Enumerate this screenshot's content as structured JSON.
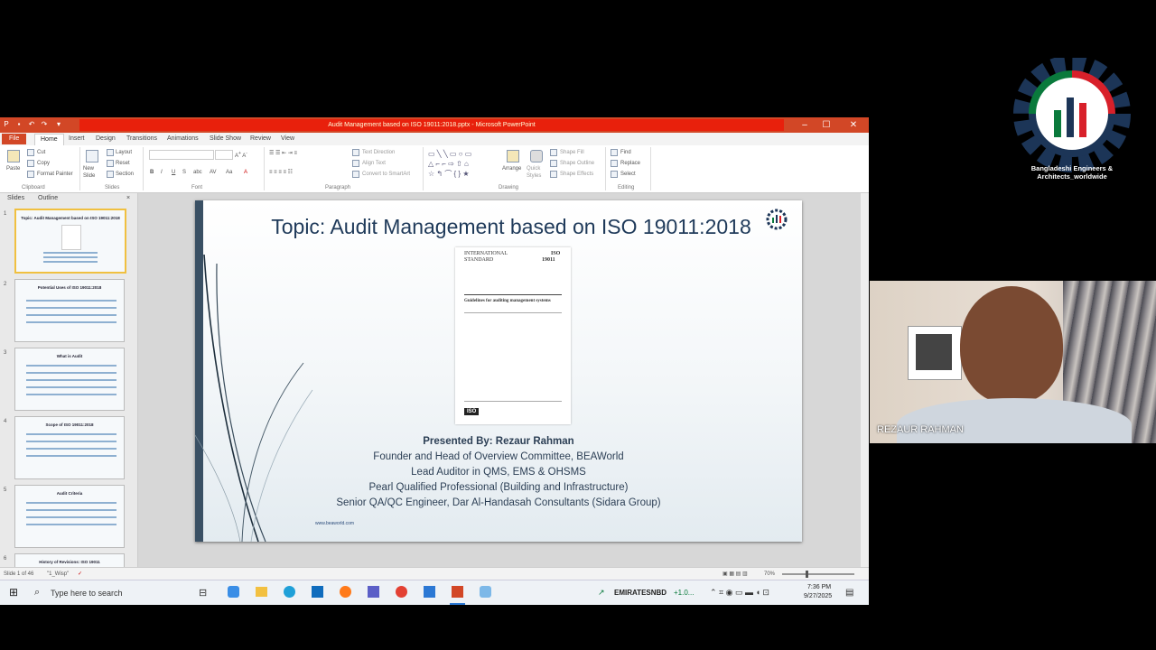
{
  "window": {
    "title": "Audit Management based on ISO 19011:2018.pptx - Microsoft PowerPoint",
    "controls": [
      "–",
      "☐",
      "✕"
    ]
  },
  "ribbon": {
    "tabs": [
      {
        "label": "File"
      },
      {
        "label": "Home"
      },
      {
        "label": "Insert"
      },
      {
        "label": "Design"
      },
      {
        "label": "Transitions"
      },
      {
        "label": "Animations"
      },
      {
        "label": "Slide Show"
      },
      {
        "label": "Review"
      },
      {
        "label": "View"
      }
    ],
    "clipboard": {
      "paste": "Paste",
      "cut": "Cut",
      "copy": "Copy",
      "format_painter": "Format Painter",
      "group": "Clipboard"
    },
    "slides": {
      "new_slide": "New Slide",
      "layout": "Layout",
      "reset": "Reset",
      "section": "Section",
      "group": "Slides"
    },
    "font": {
      "group": "Font"
    },
    "paragraph": {
      "text_direction": "Text Direction",
      "align_text": "Align Text",
      "convert_smartart": "Convert to SmartArt",
      "group": "Paragraph"
    },
    "drawing": {
      "arrange": "Arrange",
      "quick_styles": "Quick Styles",
      "shape_fill": "Shape Fill",
      "shape_outline": "Shape Outline",
      "shape_effects": "Shape Effects",
      "group": "Drawing"
    },
    "editing": {
      "find": "Find",
      "replace": "Replace",
      "select": "Select",
      "group": "Editing"
    }
  },
  "panel": {
    "tabs": [
      "Slides",
      "Outline"
    ],
    "close": "×",
    "thumbnails": [
      {
        "num": "1",
        "title": "Topic: Audit Management based on ISO 19011:2018"
      },
      {
        "num": "2",
        "title": "Potential Uses of ISO 19011:2018"
      },
      {
        "num": "3",
        "title": "What is Audit"
      },
      {
        "num": "4",
        "title": "Scope of ISO 19011:2018"
      },
      {
        "num": "5",
        "title": "Audit Criteria"
      },
      {
        "num": "6",
        "title": "History of Revisions: ISO 19011"
      }
    ]
  },
  "slide": {
    "title": "Topic: Audit Management based on ISO 19011:2018",
    "doc": {
      "line1": "INTERNATIONAL",
      "line2": "STANDARD",
      "iso": "ISO",
      "number": "19011",
      "heading": "Guidelines for auditing management systems",
      "badge": "ISO"
    },
    "presenter": [
      "Presented By: Rezaur Rahman",
      "Founder and Head of Overview Committee, BEAWorld",
      "Lead Auditor in QMS, EMS & OHSMS",
      "Pearl Qualified Professional (Building and Infrastructure)",
      "Senior QA/QC Engineer, Dar Al-Handasah Consultants (Sidara Group)"
    ],
    "footer": "www.beaworld.com"
  },
  "status": {
    "slide_info": "Slide 1 of 46",
    "theme": "\"1_Wisp\"",
    "zoom": "70%"
  },
  "taskbar": {
    "search_placeholder": "Type here to search",
    "weather": "EMIRATESNBD",
    "weather_change": "+1.0...",
    "time": "7:36 PM",
    "date": "9/27/2025"
  },
  "webcam": {
    "name": "REZAUR RAHMAN"
  },
  "logo": {
    "text": "Bangladeshi Engineers & Architects_worldwide"
  },
  "colors": {
    "ppt_accent": "#d24726",
    "title_highlight": "#e8200c",
    "slide_title": "#1f3a5a",
    "logo_green": "#0a7a3c",
    "logo_red": "#d8202a",
    "logo_navy": "#1c3557"
  }
}
